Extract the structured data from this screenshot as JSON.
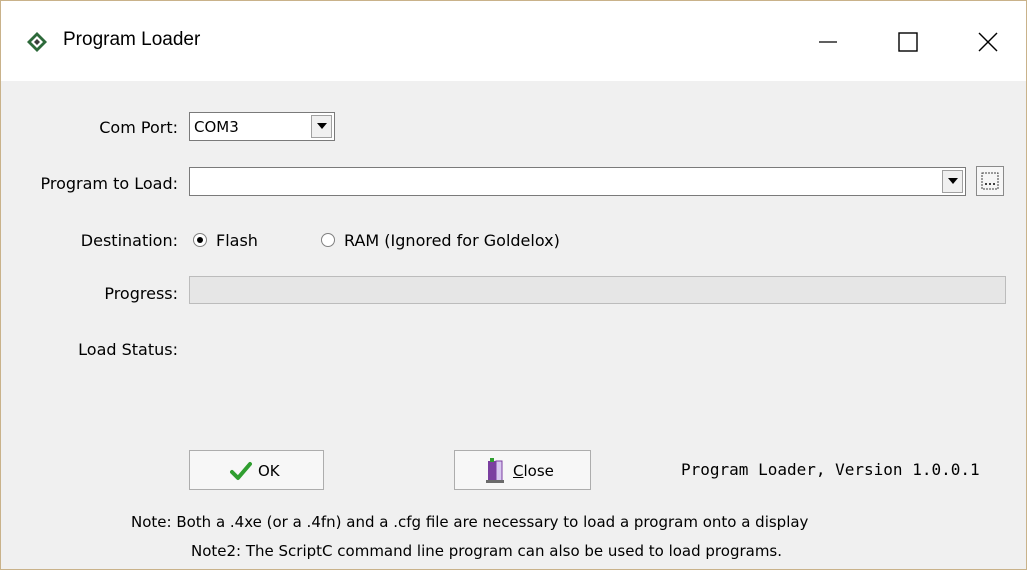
{
  "window": {
    "title": "Program Loader",
    "controls": {
      "minimize": "minimize",
      "maximize": "maximize",
      "close": "close"
    }
  },
  "form": {
    "com_port": {
      "label": "Com Port:",
      "value": "COM3"
    },
    "program": {
      "label": "Program to Load:",
      "value": ""
    },
    "destination": {
      "label": "Destination:",
      "options": [
        {
          "label": "Flash",
          "checked": true
        },
        {
          "label": "RAM (Ignored for Goldelox)",
          "checked": false
        }
      ]
    },
    "progress": {
      "label": "Progress:",
      "value": 0
    },
    "load_status": {
      "label": "Load Status:",
      "value": ""
    }
  },
  "buttons": {
    "ok": {
      "label": "OK"
    },
    "close": {
      "label_prefix": "",
      "label_underlined": "C",
      "label_rest": "lose"
    }
  },
  "version_text": "Program Loader, Version 1.0.0.1",
  "notes": {
    "note1": "Note: Both a .4xe (or a .4fn) and a .cfg file are necessary to load a program onto a display",
    "note2": "Note2: The ScriptC command line program can also be used to load programs."
  },
  "icons": {
    "app": "4d-diamond-icon",
    "ok": "checkmark-icon",
    "close": "door-exit-icon",
    "browse": "browse-folder-icon",
    "dropdown": "chevron-down-icon"
  },
  "colors": {
    "accent": "#06b025",
    "window_border": "#c9b28a",
    "dialog_bg": "#f0f0f0"
  }
}
